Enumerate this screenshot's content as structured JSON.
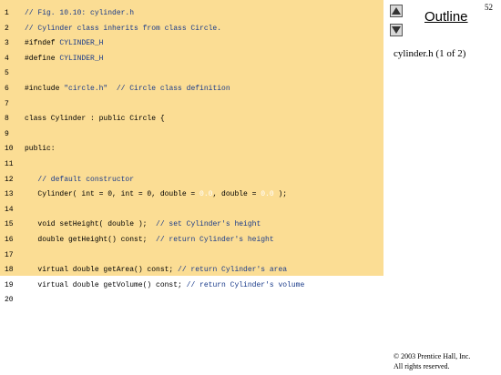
{
  "page_number": "52",
  "outline": {
    "title": "Outline",
    "subtitle": "cylinder.h (1 of 2)",
    "up_icon": "triangle-up-icon",
    "down_icon": "triangle-down-icon"
  },
  "code": [
    {
      "n": "1",
      "segments": [
        {
          "t": "// Fig. 10.10: cylinder.h",
          "c": "comment"
        }
      ]
    },
    {
      "n": "2",
      "segments": [
        {
          "t": "// Cylinder class inherits from class Circle.",
          "c": "comment"
        }
      ]
    },
    {
      "n": "3",
      "segments": [
        {
          "t": "#ifndef ",
          "c": "kw"
        },
        {
          "t": "CYLINDER_H",
          "c": "comment"
        }
      ]
    },
    {
      "n": "4",
      "segments": [
        {
          "t": "#define ",
          "c": "kw"
        },
        {
          "t": "CYLINDER_H",
          "c": "comment"
        }
      ]
    },
    {
      "n": "5",
      "segments": []
    },
    {
      "n": "6",
      "segments": [
        {
          "t": "#include ",
          "c": "kw"
        },
        {
          "t": "\"circle.h\"",
          "c": "str"
        },
        {
          "t": "  // Circle class definition",
          "c": "comment"
        }
      ]
    },
    {
      "n": "7",
      "segments": []
    },
    {
      "n": "8",
      "segments": [
        {
          "t": "class Cylinder : public Circle {",
          "c": "kw"
        }
      ]
    },
    {
      "n": "9",
      "segments": []
    },
    {
      "n": "10",
      "segments": [
        {
          "t": "public:",
          "c": "kw"
        }
      ]
    },
    {
      "n": "11",
      "segments": []
    },
    {
      "n": "12",
      "segments": [
        {
          "t": "   // default constructor",
          "c": "comment"
        }
      ]
    },
    {
      "n": "13",
      "segments": [
        {
          "t": "   Cylinder( int = 0, int = 0, double = ",
          "c": "kw"
        },
        {
          "t": "0.0",
          "c": "num"
        },
        {
          "t": ", double = ",
          "c": "kw"
        },
        {
          "t": "0.0",
          "c": "num"
        },
        {
          "t": " );",
          "c": "kw"
        }
      ]
    },
    {
      "n": "14",
      "segments": []
    },
    {
      "n": "15",
      "segments": [
        {
          "t": "   void setHeight( double );  ",
          "c": "kw"
        },
        {
          "t": "// set Cylinder's height",
          "c": "comment"
        }
      ]
    },
    {
      "n": "16",
      "segments": [
        {
          "t": "   double getHeight() const;  ",
          "c": "kw"
        },
        {
          "t": "// return Cylinder's height",
          "c": "comment"
        }
      ]
    },
    {
      "n": "17",
      "segments": []
    },
    {
      "n": "18",
      "segments": [
        {
          "t": "   virtual double getArea() const; ",
          "c": "kw"
        },
        {
          "t": "// return Cylinder's area",
          "c": "comment"
        }
      ]
    },
    {
      "n": "19",
      "segments": [
        {
          "t": "   virtual double getVolume() const; ",
          "c": "kw"
        },
        {
          "t": "// return Cylinder's volume",
          "c": "comment"
        }
      ]
    },
    {
      "n": "20",
      "segments": []
    }
  ],
  "copyright": {
    "line1": "© 2003 Prentice Hall, Inc.",
    "line2": "All rights reserved."
  }
}
